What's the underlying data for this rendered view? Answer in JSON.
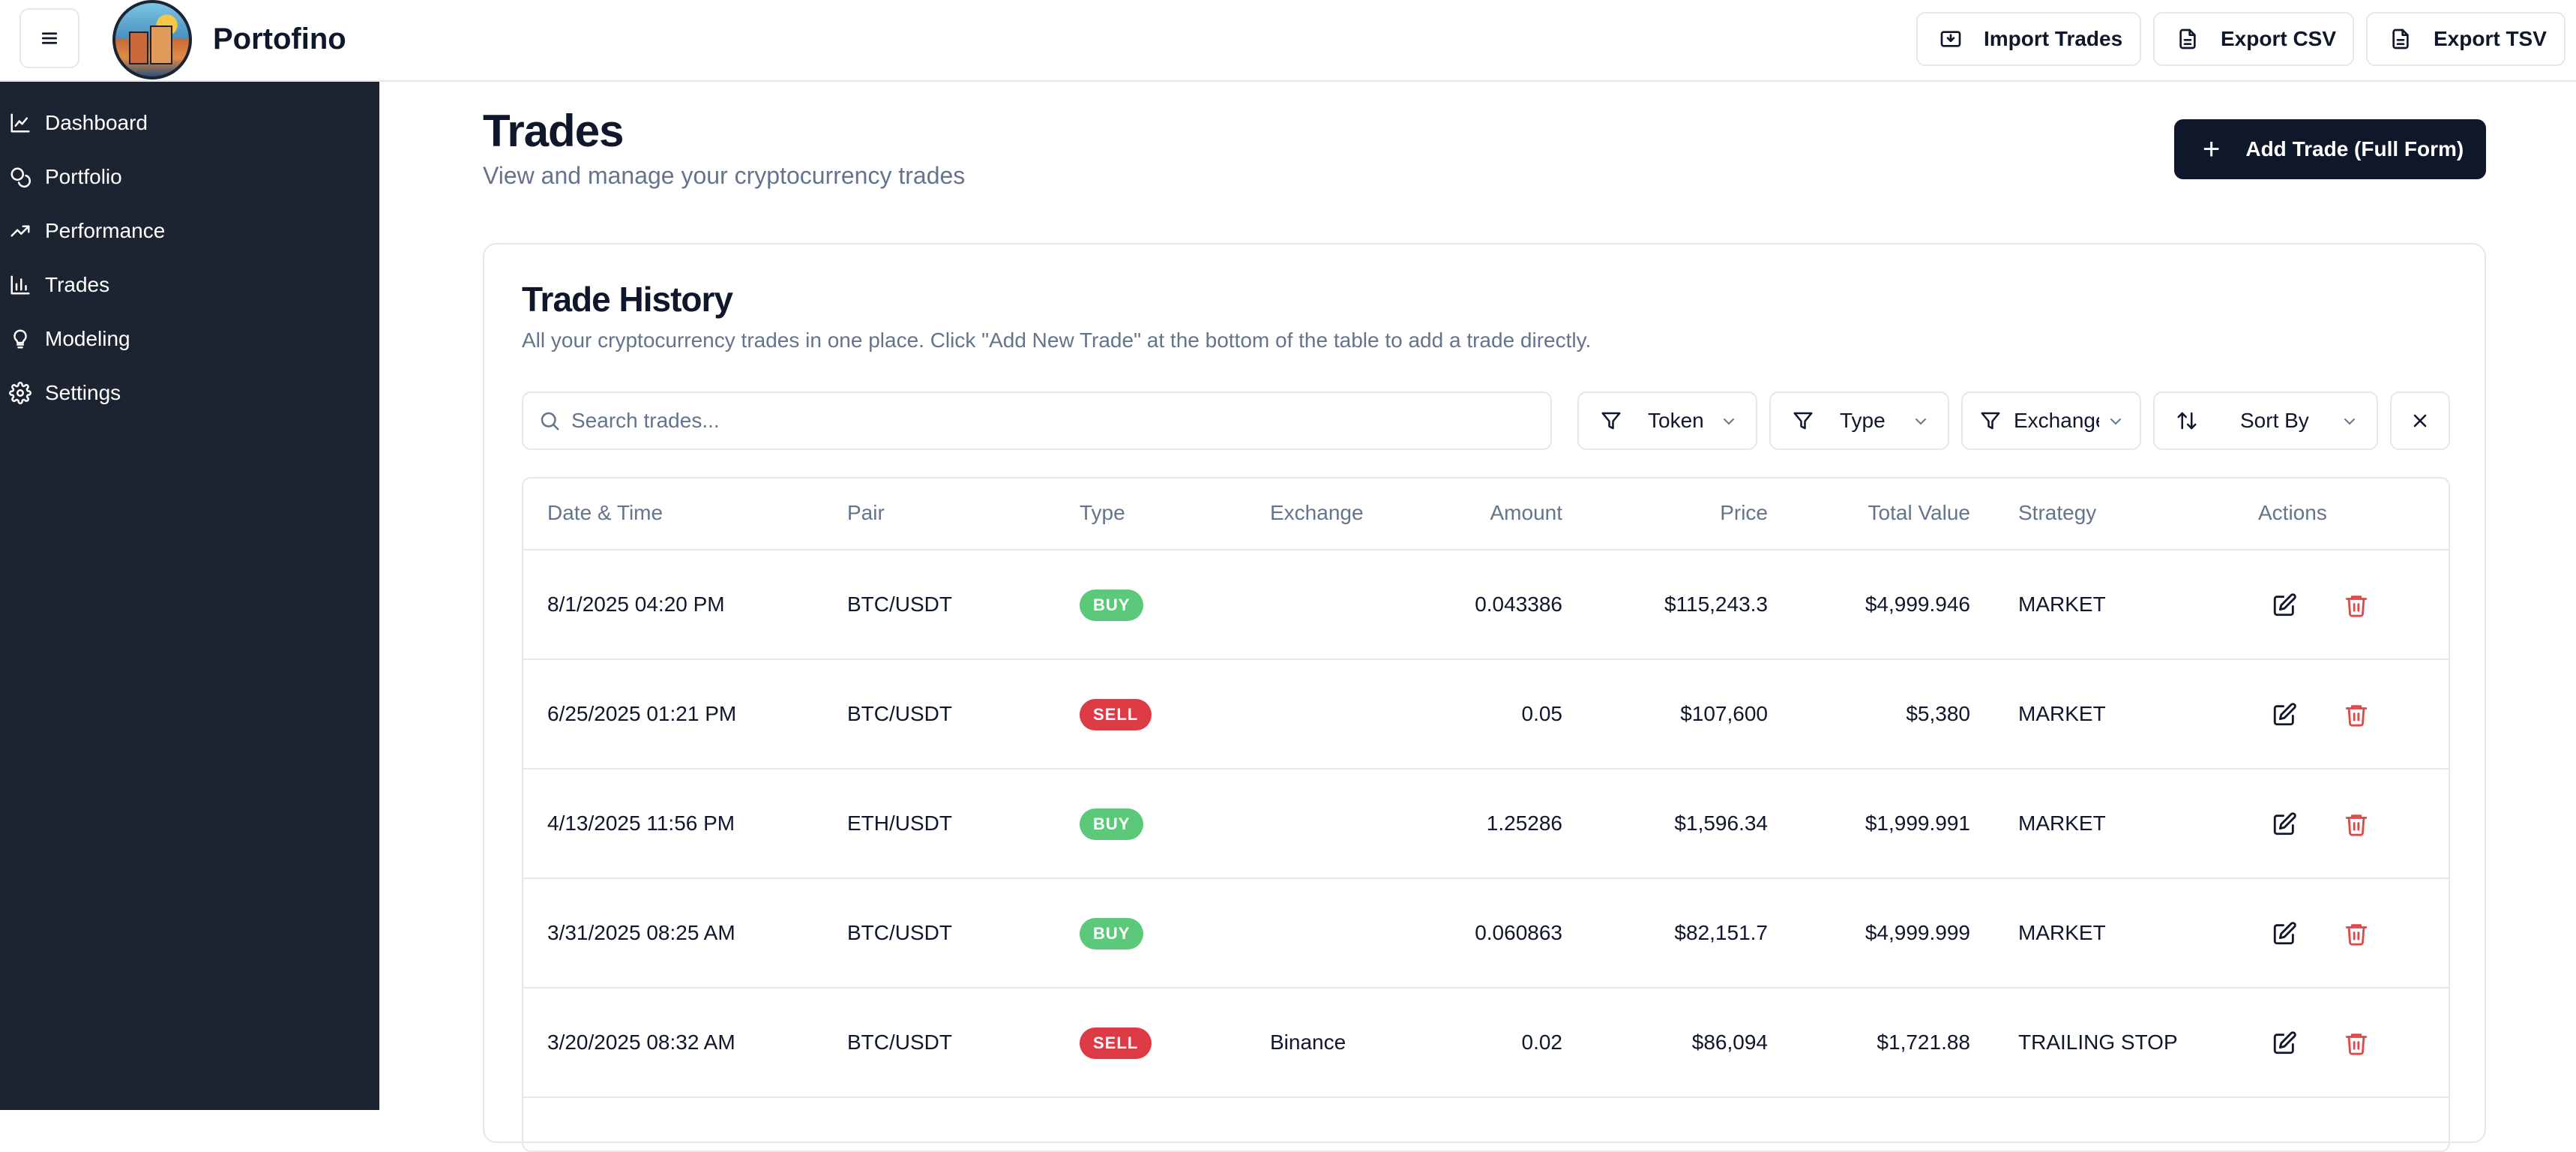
{
  "header": {
    "brand": "Portofino",
    "buttons": [
      "Import Trades",
      "Export CSV",
      "Export TSV"
    ]
  },
  "sidebar": {
    "items": [
      {
        "label": "Dashboard",
        "icon": "chart-area-icon"
      },
      {
        "label": "Portfolio",
        "icon": "coins-icon"
      },
      {
        "label": "Performance",
        "icon": "trending-up-icon"
      },
      {
        "label": "Trades",
        "icon": "bar-chart-icon"
      },
      {
        "label": "Modeling",
        "icon": "lightbulb-icon"
      },
      {
        "label": "Settings",
        "icon": "gear-icon"
      }
    ]
  },
  "page": {
    "title": "Trades",
    "subtitle": "View and manage your cryptocurrency trades",
    "add_button": "Add Trade (Full Form)"
  },
  "card": {
    "title": "Trade History",
    "subtitle": "All your cryptocurrency trades in one place. Click \"Add New Trade\" at the bottom of the table to add a trade directly.",
    "search_placeholder": "Search trades...",
    "filters": [
      "Token",
      "Type",
      "Exchange",
      "Sort By"
    ]
  },
  "table": {
    "columns": [
      "Date & Time",
      "Pair",
      "Type",
      "Exchange",
      "Amount",
      "Price",
      "Total Value",
      "Strategy",
      "Actions"
    ],
    "rows": [
      {
        "date": "8/1/2025 04:20 PM",
        "pair": "BTC/USDT",
        "type": "BUY",
        "exchange": "",
        "amount": "0.043386",
        "price": "$115,243.3",
        "total": "$4,999.946",
        "strategy": "MARKET"
      },
      {
        "date": "6/25/2025 01:21 PM",
        "pair": "BTC/USDT",
        "type": "SELL",
        "exchange": "",
        "amount": "0.05",
        "price": "$107,600",
        "total": "$5,380",
        "strategy": "MARKET"
      },
      {
        "date": "4/13/2025 11:56 PM",
        "pair": "ETH/USDT",
        "type": "BUY",
        "exchange": "",
        "amount": "1.25286",
        "price": "$1,596.34",
        "total": "$1,999.991",
        "strategy": "MARKET"
      },
      {
        "date": "3/31/2025 08:25 AM",
        "pair": "BTC/USDT",
        "type": "BUY",
        "exchange": "",
        "amount": "0.060863",
        "price": "$82,151.7",
        "total": "$4,999.999",
        "strategy": "MARKET"
      },
      {
        "date": "3/20/2025 08:32 AM",
        "pair": "BTC/USDT",
        "type": "SELL",
        "exchange": "Binance",
        "amount": "0.02",
        "price": "$86,094",
        "total": "$1,721.88",
        "strategy": "TRAILING STOP"
      }
    ]
  },
  "colors": {
    "sidebar_bg": "#1c2331",
    "buy": "#5cc97a",
    "sell": "#dc3b45",
    "delete": "#e04848",
    "primary": "#0f172a"
  }
}
